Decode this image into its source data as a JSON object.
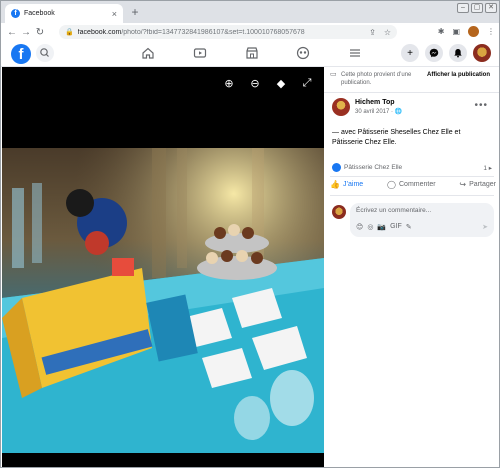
{
  "browser": {
    "tab_title": "Facebook",
    "tab_close": "×",
    "new_tab": "+",
    "url_host": "facebook.com",
    "url_path": "/photo/?fbid=1347732841986107&set=t.100010768057678",
    "window_controls": [
      "–",
      "▢",
      "✕"
    ]
  },
  "viewer": {
    "tools": [
      "zoom-in-icon",
      "zoom-out-icon",
      "tag-icon",
      "fullscreen-icon"
    ]
  },
  "sidebar": {
    "notice_text": "Cette photo provient d’une publication.",
    "notice_link": "Afficher la publication",
    "author_name": "Hichem Top",
    "post_date": "30 avril 2017 · 🌐",
    "more": "•••",
    "caption": "— avec Pâtisserie Sheselles Chez Elle et Pâtisserie Chez Elle.",
    "tag_label": "Pâtisserie Chez Elle",
    "tag_count": "1 ▸",
    "actions": {
      "like": "J’aime",
      "comment": "Commenter",
      "share": "Partager"
    },
    "comment_placeholder": "Écrivez un commentaire...",
    "comment_tools": [
      "😊",
      "◎",
      "📷",
      "GIF",
      "✎"
    ],
    "send": "➤"
  }
}
